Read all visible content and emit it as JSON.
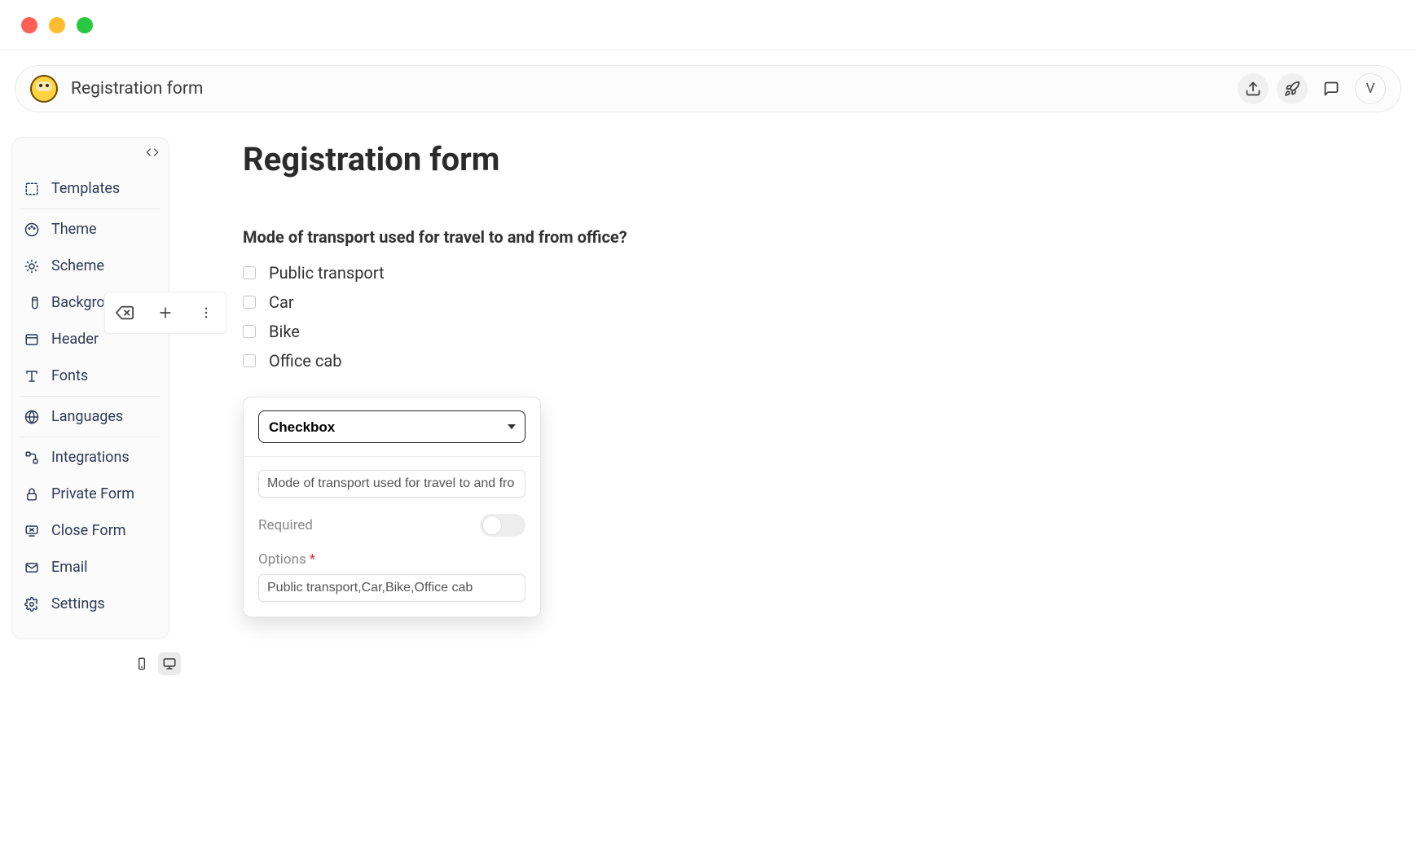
{
  "header": {
    "title": "Registration form",
    "user_initial": "V"
  },
  "sidebar": {
    "templates": "Templates",
    "theme": "Theme",
    "scheme": "Scheme",
    "background": "Backgro",
    "headerItem": "Header",
    "fonts": "Fonts",
    "languages": "Languages",
    "integrations": "Integrations",
    "private_form": "Private Form",
    "close_form": "Close Form",
    "email": "Email",
    "settings": "Settings"
  },
  "form": {
    "title": "Registration form",
    "question": "Mode of transport used for travel to and from office?",
    "options": [
      "Public transport",
      "Car",
      "Bike",
      "Office cab"
    ]
  },
  "editor": {
    "type": "Checkbox",
    "question_value": "Mode of transport used for travel to and fro",
    "required_label": "Required",
    "options_label": "Options",
    "options_value": "Public transport,Car,Bike,Office cab"
  }
}
